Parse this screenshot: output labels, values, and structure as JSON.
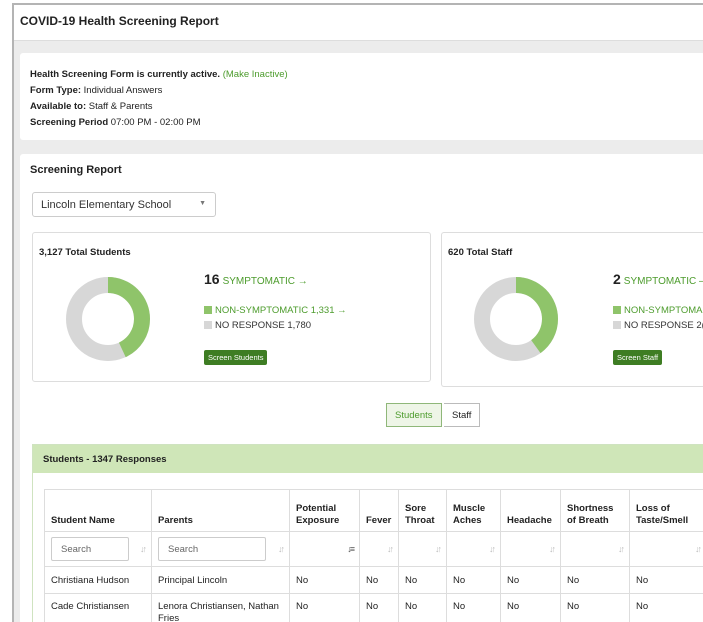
{
  "header": {
    "title": "COVID-19 Health Screening Report"
  },
  "form_info": {
    "status_label": "Health Screening Form is currently active.",
    "status_link": "(Make Inactive)",
    "form_type_label": "Form Type:",
    "form_type_value": "Individual Answers",
    "available_label": "Available to:",
    "available_value": "Staff & Parents",
    "period_label": "Screening Period",
    "period_value": "07:00 PM - 02:00 PM"
  },
  "report": {
    "heading": "Screening Report",
    "school_select": "Lincoln Elementary School"
  },
  "students_stat": {
    "title": "3,127 Total Students",
    "symptomatic_count": "16",
    "symptomatic_label": "SYMPTOMATIC →",
    "non_symptomatic": "NON-SYMPTOMATIC 1,331 →",
    "no_response": "NO RESPONSE 1,780",
    "button": "Screen Students",
    "donut_fraction": 0.43
  },
  "staff_stat": {
    "title": "620 Total Staff",
    "symptomatic_count": "2",
    "symptomatic_label": "SYMPTOMATIC –",
    "non_symptomatic": "NON-SYMPTOMA",
    "no_response": "NO RESPONSE 2(",
    "button": "Screen Staff",
    "donut_fraction": 0.4
  },
  "toggle": {
    "students": "Students",
    "staff": "Staff"
  },
  "table": {
    "header": "Students - 1347 Responses",
    "columns": [
      "Student Name",
      "Parents",
      "Potential Exposure",
      "Fever",
      "Sore Throat",
      "Muscle Aches",
      "Headache",
      "Shortness of Breath",
      "Loss of Taste/Smell"
    ],
    "search_placeholder": "Search",
    "rows": [
      [
        "Christiana Hudson",
        "Principal Lincoln",
        "No",
        "No",
        "No",
        "No",
        "No",
        "No",
        "No"
      ],
      [
        "Cade Christiansen",
        "Lenora Christiansen, Nathan Fries",
        "No",
        "No",
        "No",
        "No",
        "No",
        "No",
        "No"
      ]
    ]
  },
  "colors": {
    "accent_green": "#4d9c2d",
    "donut_green": "#8fc46a",
    "donut_gray": "#d7d7d7",
    "button_green": "#3e7d23"
  }
}
